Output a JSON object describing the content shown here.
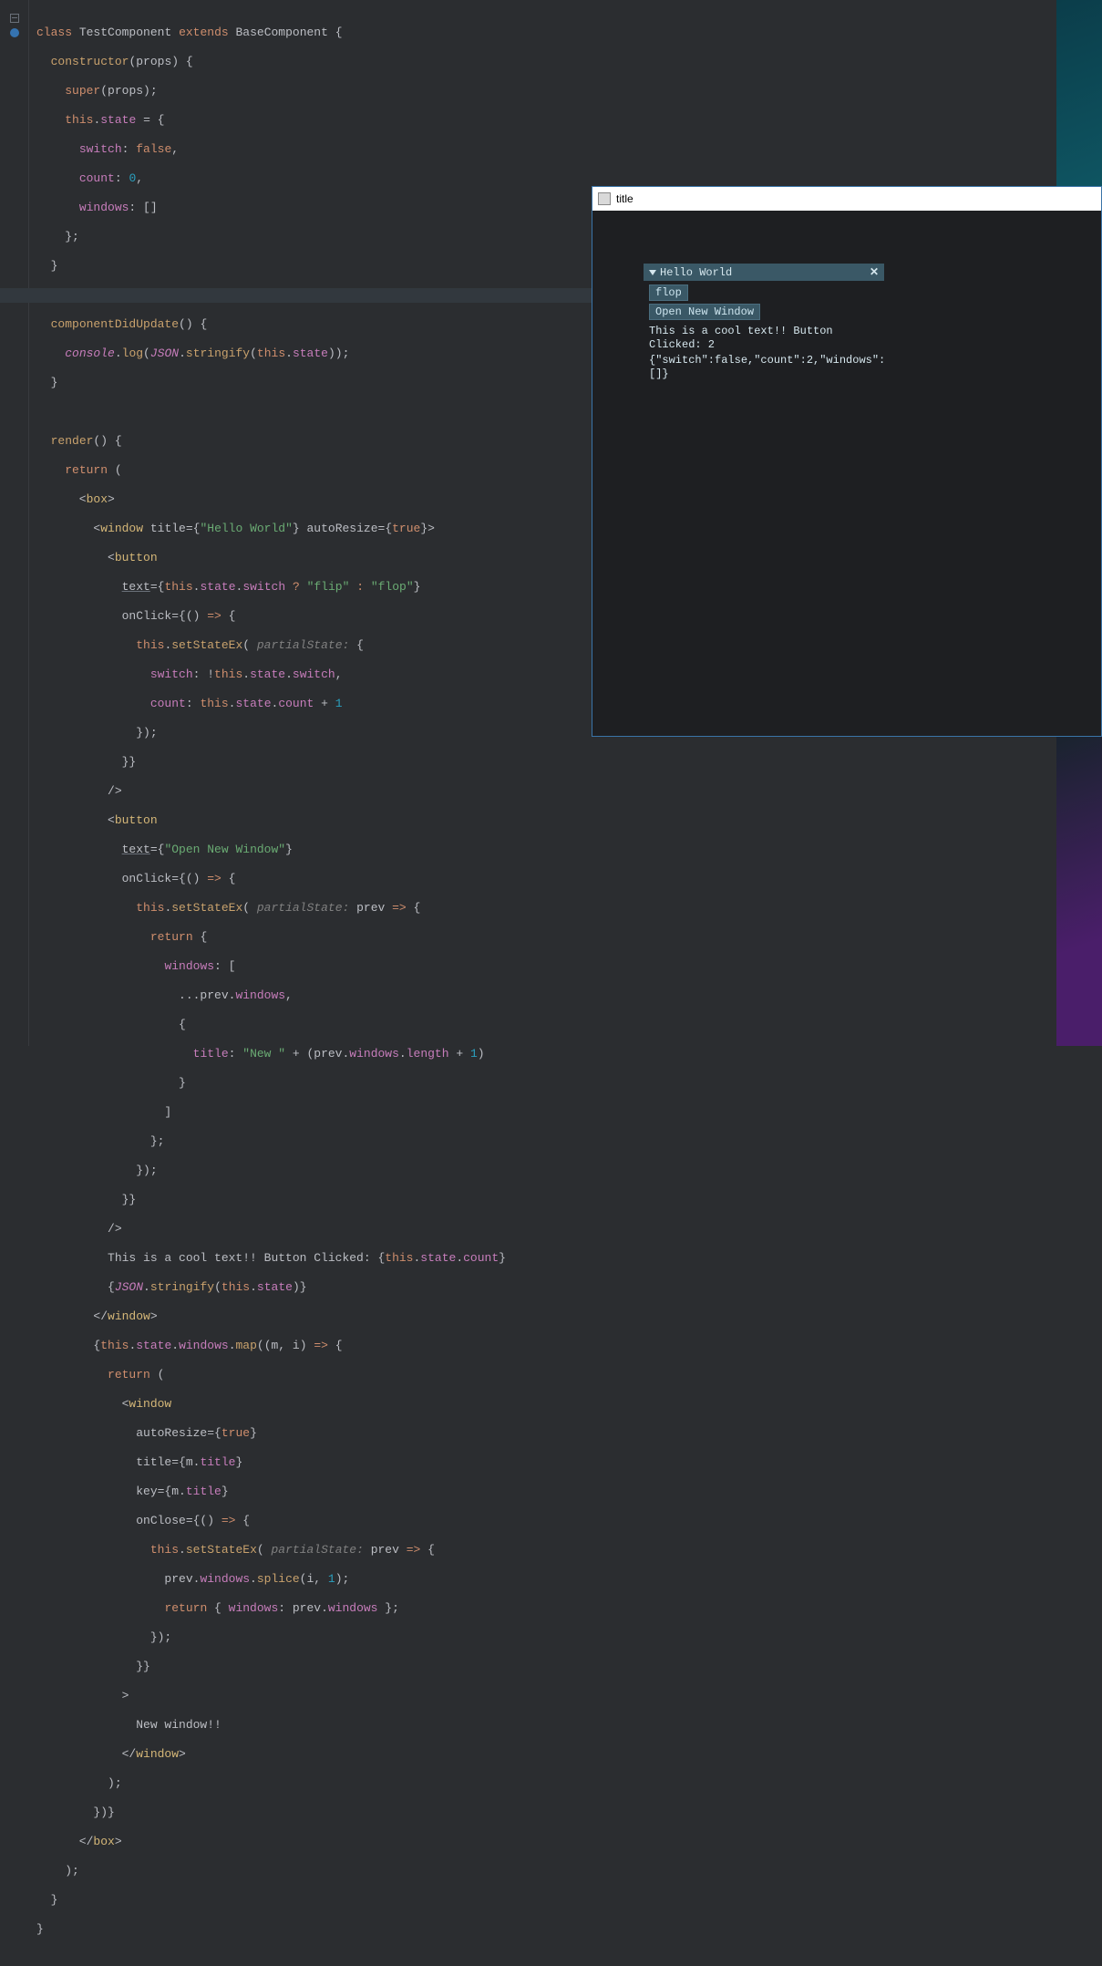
{
  "code": {
    "lines": [
      "class TestComponent extends BaseComponent {",
      "  constructor(props) {",
      "    super(props);",
      "    this.state = {",
      "      switch: false,",
      "      count: 0,",
      "      windows: []",
      "    };",
      "  }",
      "",
      "  componentDidUpdate() {",
      "    console.log(JSON.stringify(this.state));",
      "  }",
      "",
      "  render() {",
      "    return (",
      "      <box>",
      "        <window title={\"Hello World\"} autoResize={true}>",
      "          <button",
      "            text={this.state.switch ? \"flip\" : \"flop\"}",
      "            onClick={() => {",
      "              this.setStateEx( partialState: {",
      "                switch: !this.state.switch,",
      "                count: this.state.count + 1",
      "              });",
      "            }}",
      "          />",
      "          <button",
      "            text={\"Open New Window\"}",
      "            onClick={() => {",
      "              this.setStateEx( partialState: prev => {",
      "                return {",
      "                  windows: [",
      "                    ...prev.windows,",
      "                    {",
      "                      title: \"New \" + (prev.windows.length + 1)",
      "                    }",
      "                  ]",
      "                };",
      "              });",
      "            }}",
      "          />",
      "          This is a cool text!! Button Clicked: {this.state.count}",
      "          {JSON.stringify(this.state)}",
      "        </window>",
      "        {this.state.windows.map((m, i) => {",
      "          return (",
      "            <window",
      "              autoResize={true}",
      "              title={m.title}",
      "              key={m.title}",
      "              onClose={() => {",
      "                this.setStateEx( partialState: prev => {",
      "                  prev.windows.splice(i, 1);",
      "                  return { windows: prev.windows };",
      "                });",
      "              }}",
      "            >",
      "              New window!!",
      "            </window>",
      "          );",
      "        })}",
      "      </box>",
      "    );",
      "  }",
      "}"
    ]
  },
  "app": {
    "outer_title": "title",
    "inner_title": "Hello World",
    "btn1": "flop",
    "btn2": "Open New Window",
    "text1": "This is a cool text!! Button Clicked: 2",
    "text2": "{\"switch\":false,\"count\":2,\"windows\":[]}"
  }
}
